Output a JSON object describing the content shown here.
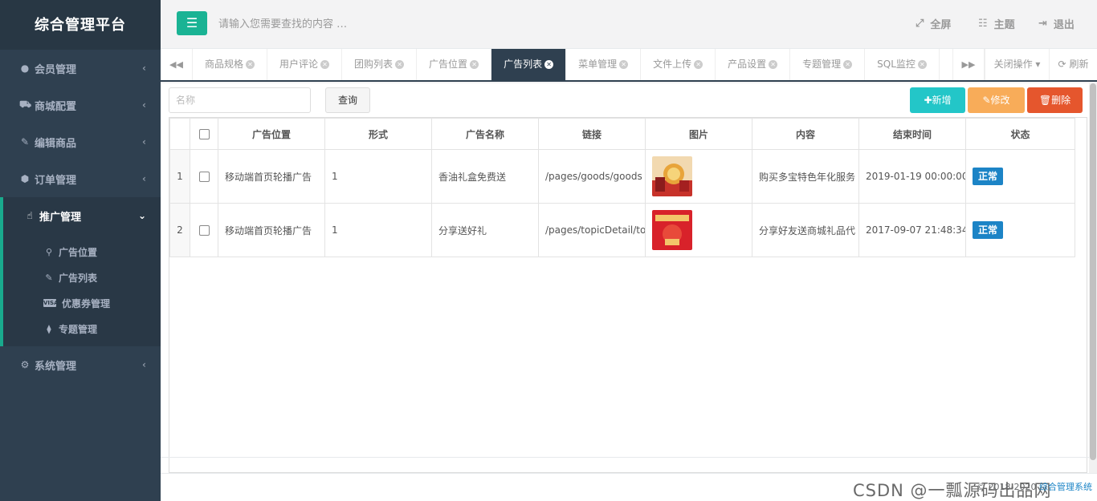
{
  "sidebar": {
    "brand": "综合管理平台",
    "items": [
      {
        "label": "会员管理",
        "icon": "user-circle-icon"
      },
      {
        "label": "商城配置",
        "icon": "shopping-cart-icon"
      },
      {
        "label": "编辑商品",
        "icon": "edit-icon"
      },
      {
        "label": "订单管理",
        "icon": "cube-icon"
      },
      {
        "label": "推广管理",
        "icon": "hand-pointer-icon"
      },
      {
        "label": "系统管理",
        "icon": "gear-icon"
      }
    ],
    "sub_items": [
      {
        "label": "广告位置",
        "icon": "map-marker-icon"
      },
      {
        "label": "广告列表",
        "icon": "pencil-icon"
      },
      {
        "label": "优惠券管理",
        "icon": "visa-card-icon"
      },
      {
        "label": "专题管理",
        "icon": "tags-icon"
      }
    ]
  },
  "header": {
    "search_placeholder": "请输入您需要查找的内容 …",
    "fullscreen": "全屏",
    "theme": "主题",
    "logout": "退出"
  },
  "tabs": {
    "items": [
      "商品规格",
      "用户评论",
      "团购列表",
      "广告位置",
      "广告列表",
      "菜单管理",
      "文件上传",
      "产品设置",
      "专题管理",
      "SQL监控"
    ],
    "active_index": 4,
    "close_ops": "关闭操作",
    "refresh": "刷新"
  },
  "toolbar": {
    "name_placeholder": "名称",
    "query": "查询",
    "add": "新增",
    "edit": "修改",
    "delete": "删除"
  },
  "table": {
    "columns": [
      "广告位置",
      "形式",
      "广告名称",
      "链接",
      "图片",
      "内容",
      "结束时间",
      "状态"
    ],
    "rows": [
      {
        "index": "1",
        "position": "移动端首页轮播广告",
        "form": "1",
        "name": "香油礼盒免费送",
        "link": "/pages/goods/goods",
        "content": "购买多宝特色年化服务",
        "end_time": "2019-01-19 00:00:00",
        "status": "正常"
      },
      {
        "index": "2",
        "position": "移动端首页轮播广告",
        "form": "1",
        "name": "分享送好礼",
        "link": "/pages/topicDetail/to",
        "content": "分享好友送商城礼品代",
        "end_time": "2017-09-07 21:48:34",
        "status": "正常"
      }
    ]
  },
  "footer": {
    "copyright": "© 2018-2020 ",
    "link": "综合管理系统",
    "watermark": "CSDN @一瓢源码出品网"
  },
  "colors": {
    "sidebar_bg": "#2f4050",
    "accent_green": "#1ab394",
    "add_btn": "#23c6c8",
    "edit_btn": "#f8ac59",
    "delete_btn": "#ed5565",
    "badge": "#1c84c6"
  }
}
